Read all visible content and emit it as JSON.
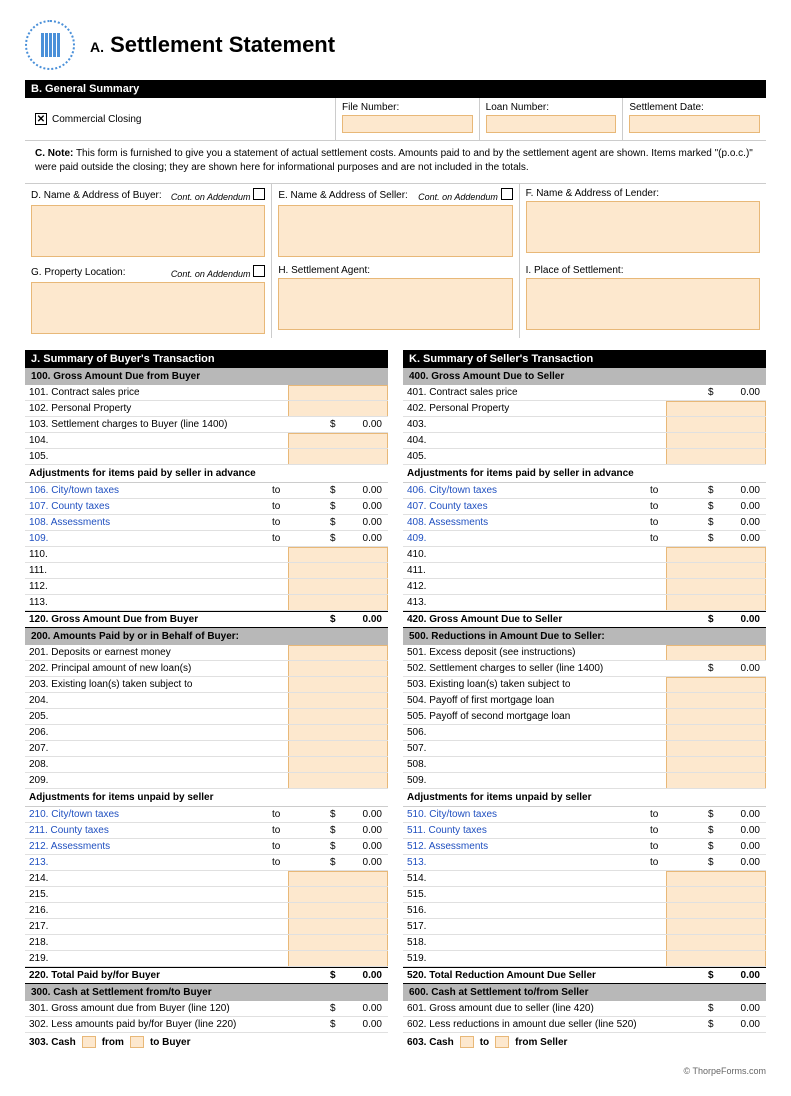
{
  "header": {
    "titleA": "A.",
    "title": "Settlement Statement"
  },
  "sectionB": {
    "title": "B. General Summary",
    "commercialClosing": "Commercial Closing",
    "fileNumber": "File Number:",
    "loanNumber": "Loan Number:",
    "settlementDate": "Settlement Date:"
  },
  "note": {
    "label": "C. Note:",
    "text": "This form is furnished to give you a statement of actual settlement costs. Amounts paid to and by the settlement agent are shown. Items marked \"(p.o.c.)\" were paid outside the closing; they are shown here for informational purposes and are not included in the totals."
  },
  "sectionD": {
    "label": "D. Name & Address of Buyer:",
    "cont": "Cont. on Addendum"
  },
  "sectionE": {
    "label": "E. Name & Address of Seller:",
    "cont": "Cont. on Addendum"
  },
  "sectionF": {
    "label": "F. Name & Address of Lender:"
  },
  "sectionG": {
    "label": "G. Property Location:",
    "cont": "Cont. on Addendum"
  },
  "sectionH": {
    "label": "H. Settlement Agent:"
  },
  "sectionI": {
    "label": "I. Place of Settlement:"
  },
  "buyer": {
    "title": "J. Summary of Buyer's Transaction",
    "h100": "100. Gross Amount Due from Buyer",
    "r101": "101. Contract sales price",
    "r102": "102. Personal Property",
    "r103": "103. Settlement charges to Buyer (line 1400)",
    "r104": "104.",
    "r105": "105.",
    "adj1": "Adjustments for items paid by seller in advance",
    "r106": "106. City/town taxes",
    "r107": "107. County taxes",
    "r108": "108. Assessments",
    "r109": "109.",
    "to": "to",
    "r110": "110.",
    "r111": "111.",
    "r112": "112.",
    "r113": "113.",
    "h120": "120. Gross Amount Due from Buyer",
    "h200": "200. Amounts Paid by or in Behalf of Buyer:",
    "r201": "201. Deposits or earnest money",
    "r202": "202. Principal amount of new loan(s)",
    "r203": "203. Existing loan(s) taken subject to",
    "r204": "204.",
    "r205": "205.",
    "r206": "206.",
    "r207": "207.",
    "r208": "208.",
    "r209": "209.",
    "adj2": "Adjustments for items unpaid by seller",
    "r210": "210. City/town taxes",
    "r211": "211. County taxes",
    "r212": "212. Assessments",
    "r213": "213.",
    "r214": "214.",
    "r215": "215.",
    "r216": "216.",
    "r217": "217.",
    "r218": "218.",
    "r219": "219.",
    "h220": "220. Total Paid by/for Buyer",
    "h300": "300. Cash at Settlement from/to Buyer",
    "r301": "301. Gross amount due from Buyer (line 120)",
    "r302": "302. Less amounts paid by/for Buyer (line 220)",
    "r303": "303. Cash",
    "from": "from",
    "toBuyer": "to Buyer"
  },
  "seller": {
    "title": "K. Summary of Seller's Transaction",
    "h400": "400. Gross Amount Due to Seller",
    "r401": "401. Contract sales price",
    "r402": "402. Personal Property",
    "r403": "403.",
    "r404": "404.",
    "r405": "405.",
    "adj1": "Adjustments for items paid by seller in advance",
    "r406": "406. City/town taxes",
    "r407": "407. County taxes",
    "r408": "408. Assessments",
    "r409": "409.",
    "to": "to",
    "r410": "410.",
    "r411": "411.",
    "r412": "412.",
    "r413": "413.",
    "h420": "420. Gross Amount Due to Seller",
    "h500": "500. Reductions in Amount Due to Seller:",
    "r501": "501. Excess deposit (see instructions)",
    "r502": "502. Settlement charges to seller (line 1400)",
    "r503": "503. Existing loan(s) taken subject to",
    "r504": "504. Payoff of first mortgage loan",
    "r505": "505. Payoff of second mortgage loan",
    "r506": "506.",
    "r507": "507.",
    "r508": "508.",
    "r509": "509.",
    "adj2": "Adjustments for items unpaid by seller",
    "r510": "510. City/town taxes",
    "r511": "511. County taxes",
    "r512": "512. Assessments",
    "r513": "513.",
    "r514": "514.",
    "r515": "515.",
    "r516": "516.",
    "r517": "517.",
    "r518": "518.",
    "r519": "519.",
    "h520": "520. Total Reduction Amount Due Seller",
    "h600": "600. Cash at Settlement to/from Seller",
    "r601": "601. Gross amount due to seller (line 420)",
    "r602": "602. Less reductions in amount due seller (line 520)",
    "r603": "603. Cash",
    "to2": "to",
    "fromSeller": "from Seller"
  },
  "amt": {
    "dollar": "$",
    "zero": "0.00"
  },
  "footer": "© ThorpeForms.com"
}
